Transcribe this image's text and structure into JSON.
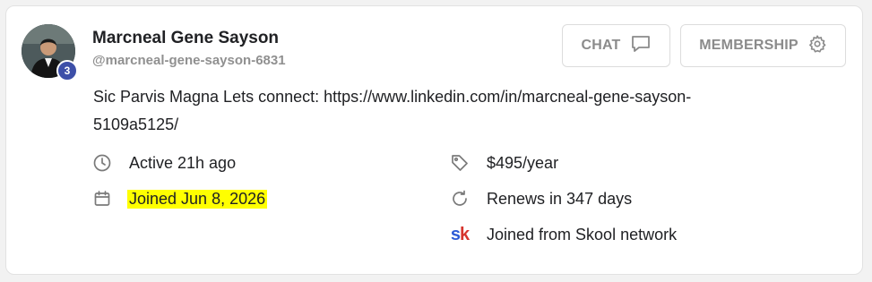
{
  "profile": {
    "name": "Marcneal Gene Sayson",
    "handle": "@marcneal-gene-sayson-6831",
    "level": "3",
    "bio_line1": "Sic Parvis Magna Lets connect: https://www.linkedin.com/in/marcneal-gene-sayson-",
    "bio_line2": "5109a5125/"
  },
  "actions": {
    "chat_label": "CHAT",
    "membership_label": "MEMBERSHIP"
  },
  "details": {
    "active": "Active 21h ago",
    "joined": "Joined Jun 8, 2026",
    "price": "$495/year",
    "renews": "Renews in 347 days",
    "source": "Joined from Skool network",
    "source_logo": "sk"
  },
  "colors": {
    "badge": "#3d4fa8",
    "highlight": "#ffff00",
    "muted": "#8b8b8b"
  },
  "icons": {
    "chat": "chat-bubble-icon",
    "membership": "gear-icon",
    "active": "clock-icon",
    "joined": "calendar-icon",
    "price": "tag-icon",
    "renews": "refresh-icon",
    "source": "skool-logo-icon"
  }
}
